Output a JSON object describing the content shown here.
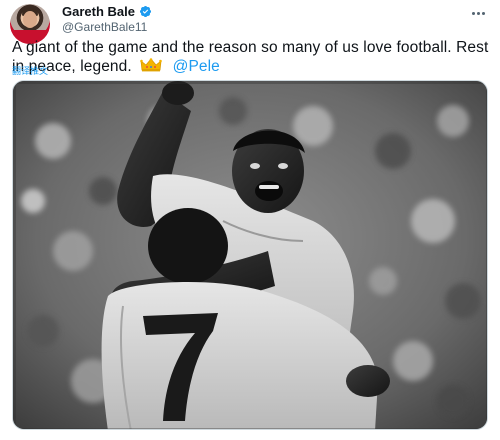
{
  "user": {
    "display_name": "Gareth Bale",
    "handle": "@GarethBale11",
    "verified": true,
    "avatar_icon": "profile-avatar"
  },
  "tweet": {
    "text_before": "A giant of the game and the reason so many of us love football. Rest in peace, legend.",
    "emoji_icon": "crown-emoji",
    "mention": "@Pele",
    "translate_label": "翻译推文"
  },
  "menu": {
    "icon": "more-options-icon"
  },
  "photo": {
    "description_icon": "photo-black-white-celebration",
    "jersey_number": "7"
  },
  "colors": {
    "accent": "#1d9bf0",
    "text": "#0f1419",
    "secondary": "#536471",
    "crown": "#f5b400"
  }
}
